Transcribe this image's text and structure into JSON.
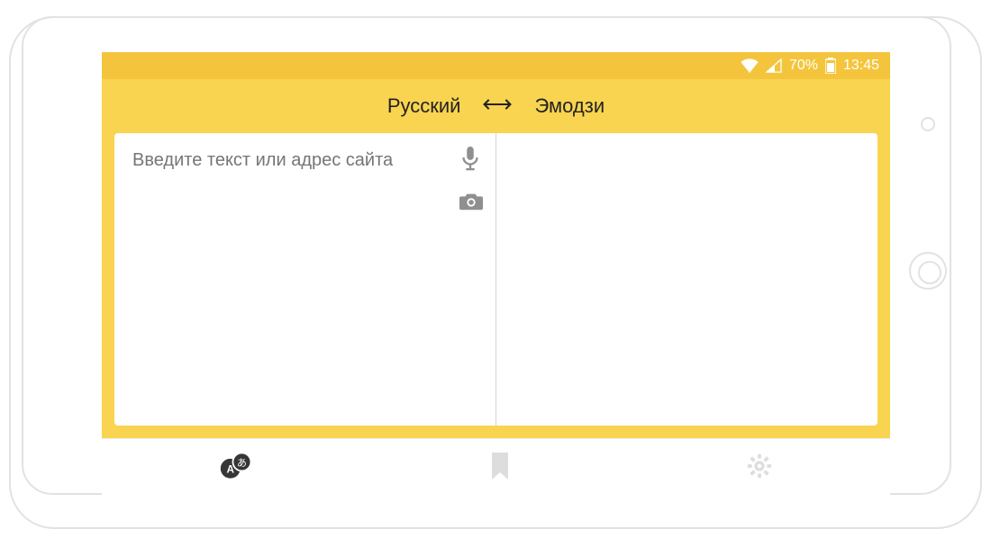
{
  "status": {
    "battery_pct": "70%",
    "clock": "13:45"
  },
  "languages": {
    "from": "Русский",
    "to": "Эмодзи"
  },
  "input": {
    "placeholder": "Введите текст или адрес сайта"
  }
}
